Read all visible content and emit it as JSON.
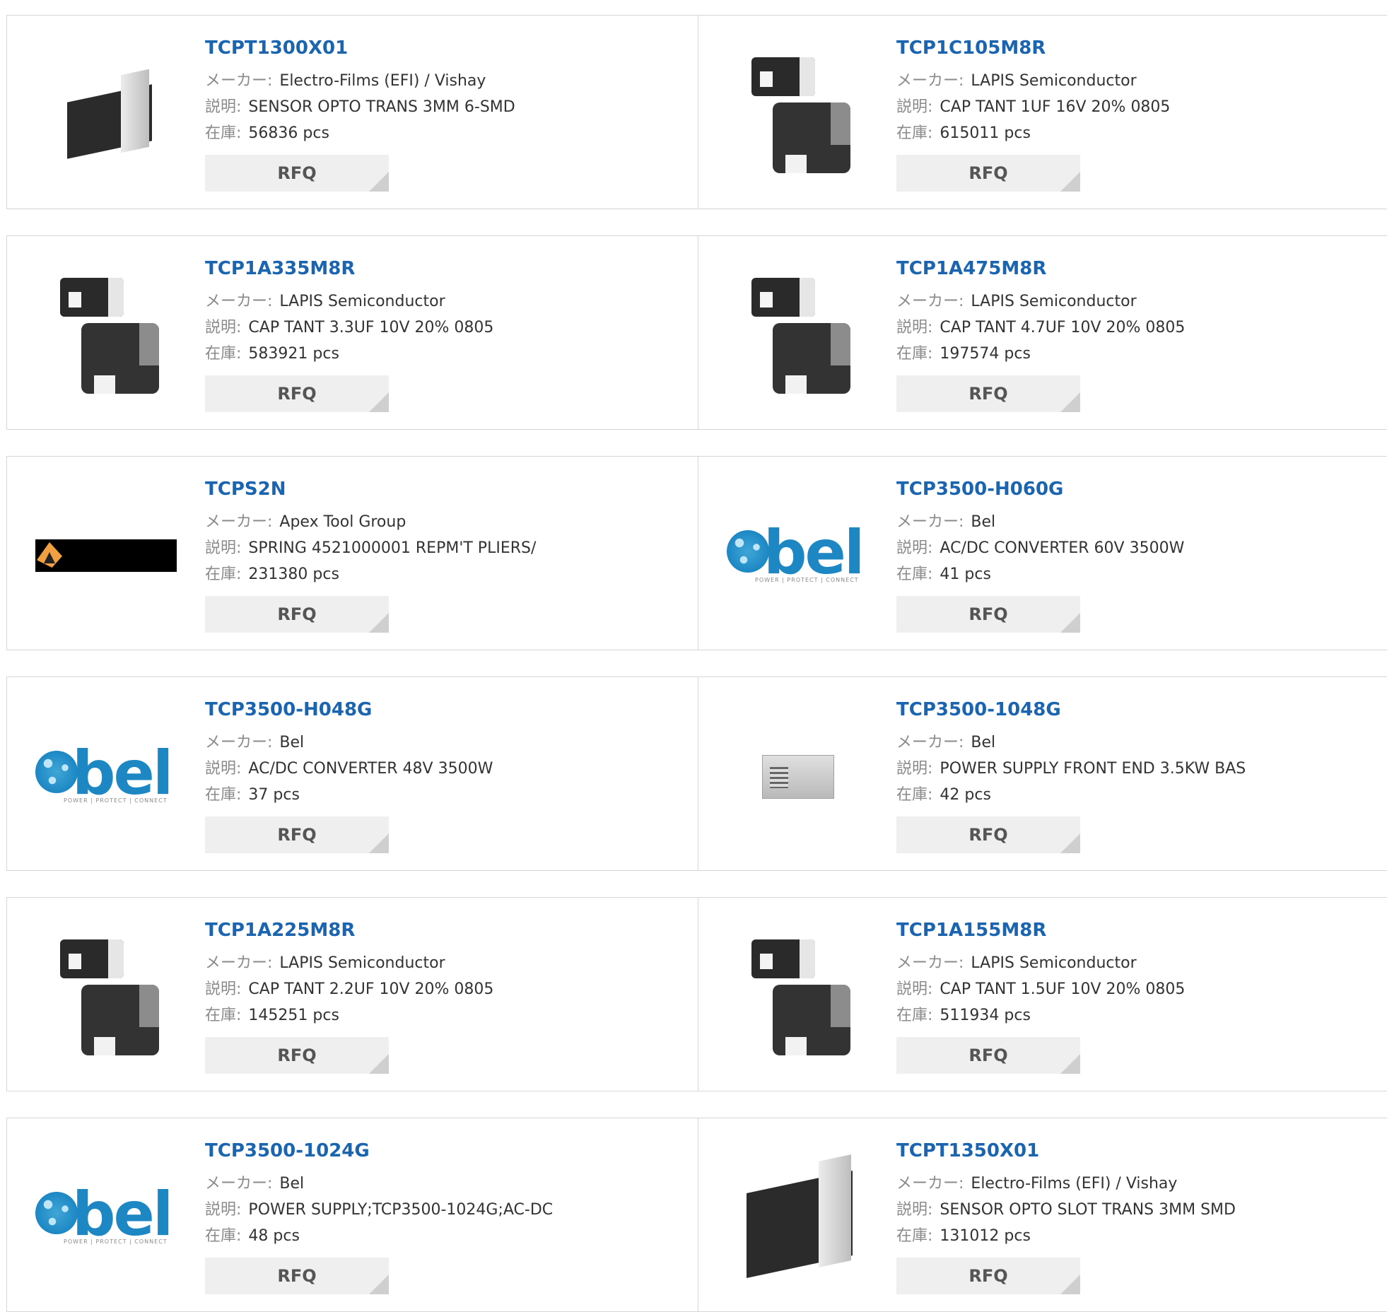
{
  "labels": {
    "manufacturer": "メーカー:",
    "description": "説明:",
    "stock": "在庫:",
    "rfq": "RFQ"
  },
  "products": [
    {
      "part": "TCPT1300X01",
      "manufacturer": "Electro-Films (EFI) / Vishay",
      "description": "SENSOR OPTO TRANS 3MM 6-SMD",
      "stock": "56836 pcs",
      "image": "opto-sensor-image"
    },
    {
      "part": "TCP1C105M8R",
      "manufacturer": "LAPIS Semiconductor",
      "description": "CAP TANT 1UF 16V 20% 0805",
      "stock": "615011 pcs",
      "image": "tantalum-capacitor-image"
    },
    {
      "part": "TCP1A335M8R",
      "manufacturer": "LAPIS Semiconductor",
      "description": "CAP TANT 3.3UF 10V 20% 0805",
      "stock": "583921 pcs",
      "image": "tantalum-capacitor-image"
    },
    {
      "part": "TCP1A475M8R",
      "manufacturer": "LAPIS Semiconductor",
      "description": "CAP TANT 4.7UF 10V 20% 0805",
      "stock": "197574 pcs",
      "image": "tantalum-capacitor-image"
    },
    {
      "part": "TCPS2N",
      "manufacturer": "Apex Tool Group",
      "description": "SPRING 4521000001 REPM'T PLIERS/",
      "stock": "231380 pcs",
      "image": "apex-logo-image"
    },
    {
      "part": "TCP3500-H060G",
      "manufacturer": "Bel",
      "description": "AC/DC CONVERTER 60V 3500W",
      "stock": "41 pcs",
      "image": "bel-logo-image"
    },
    {
      "part": "TCP3500-H048G",
      "manufacturer": "Bel",
      "description": "AC/DC CONVERTER 48V 3500W",
      "stock": "37 pcs",
      "image": "bel-logo-image"
    },
    {
      "part": "TCP3500-1048G",
      "manufacturer": "Bel",
      "description": "POWER SUPPLY FRONT END 3.5KW BAS",
      "stock": "42 pcs",
      "image": "power-supply-image"
    },
    {
      "part": "TCP1A225M8R",
      "manufacturer": "LAPIS Semiconductor",
      "description": "CAP TANT 2.2UF 10V 20% 0805",
      "stock": "145251 pcs",
      "image": "tantalum-capacitor-image"
    },
    {
      "part": "TCP1A155M8R",
      "manufacturer": "LAPIS Semiconductor",
      "description": "CAP TANT 1.5UF 10V 20% 0805",
      "stock": "511934 pcs",
      "image": "tantalum-capacitor-image"
    },
    {
      "part": "TCP3500-1024G",
      "manufacturer": "Bel",
      "description": "POWER SUPPLY;TCP3500-1024G;AC-DC",
      "stock": "48 pcs",
      "image": "bel-logo-image"
    },
    {
      "part": "TCPT1350X01",
      "manufacturer": "Electro-Films (EFI) / Vishay",
      "description": "SENSOR OPTO SLOT TRANS 3MM SMD",
      "stock": "131012 pcs",
      "image": "opto-sensor-image"
    }
  ],
  "bel_logo": {
    "word": "bel",
    "tagline": "POWER | PROTECT | CONNECT"
  }
}
